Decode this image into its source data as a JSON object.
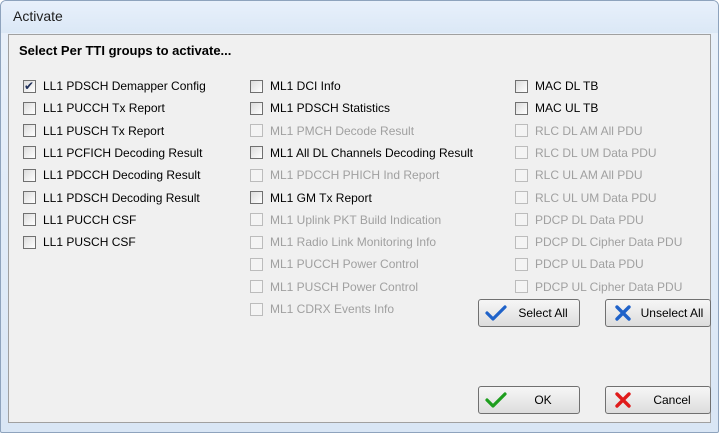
{
  "window": {
    "title": "Activate"
  },
  "header": "Select Per TTI groups to activate...",
  "columns": [
    [
      {
        "label": "LL1 PDSCH Demapper Config",
        "checked": true,
        "enabled": true
      },
      {
        "label": "LL1 PUCCH Tx Report",
        "checked": false,
        "enabled": true
      },
      {
        "label": "LL1 PUSCH Tx Report",
        "checked": false,
        "enabled": true
      },
      {
        "label": "LL1 PCFICH Decoding Result",
        "checked": false,
        "enabled": true
      },
      {
        "label": "LL1 PDCCH Decoding Result",
        "checked": false,
        "enabled": true
      },
      {
        "label": "LL1 PDSCH Decoding Result",
        "checked": false,
        "enabled": true
      },
      {
        "label": "LL1 PUCCH CSF",
        "checked": false,
        "enabled": true
      },
      {
        "label": "LL1 PUSCH CSF",
        "checked": false,
        "enabled": true
      }
    ],
    [
      {
        "label": "ML1 DCI Info",
        "checked": false,
        "enabled": true
      },
      {
        "label": "ML1 PDSCH Statistics",
        "checked": false,
        "enabled": true
      },
      {
        "label": "ML1 PMCH Decode Result",
        "checked": false,
        "enabled": false
      },
      {
        "label": "ML1 All DL Channels Decoding Result",
        "checked": false,
        "enabled": true
      },
      {
        "label": "ML1 PDCCH PHICH Ind Report",
        "checked": false,
        "enabled": false
      },
      {
        "label": "ML1 GM Tx Report",
        "checked": false,
        "enabled": true
      },
      {
        "label": "ML1 Uplink PKT Build Indication",
        "checked": false,
        "enabled": false
      },
      {
        "label": "ML1 Radio Link Monitoring Info",
        "checked": false,
        "enabled": false
      },
      {
        "label": "ML1 PUCCH Power Control",
        "checked": false,
        "enabled": false
      },
      {
        "label": "ML1 PUSCH Power Control",
        "checked": false,
        "enabled": false
      },
      {
        "label": "ML1 CDRX Events Info",
        "checked": false,
        "enabled": false
      }
    ],
    [
      {
        "label": "MAC DL TB",
        "checked": false,
        "enabled": true
      },
      {
        "label": "MAC UL TB",
        "checked": false,
        "enabled": true
      },
      {
        "label": "RLC DL AM All PDU",
        "checked": false,
        "enabled": false
      },
      {
        "label": "RLC DL UM Data PDU",
        "checked": false,
        "enabled": false
      },
      {
        "label": "RLC UL AM All PDU",
        "checked": false,
        "enabled": false
      },
      {
        "label": "RLC UL UM Data PDU",
        "checked": false,
        "enabled": false
      },
      {
        "label": "PDCP DL Data PDU",
        "checked": false,
        "enabled": false
      },
      {
        "label": "PDCP DL Cipher Data PDU",
        "checked": false,
        "enabled": false
      },
      {
        "label": "PDCP UL Data PDU",
        "checked": false,
        "enabled": false
      },
      {
        "label": "PDCP UL Cipher Data PDU",
        "checked": false,
        "enabled": false
      }
    ]
  ],
  "buttons": {
    "select_all": "Select All",
    "unselect_all": "Unselect All",
    "ok": "OK",
    "cancel": "Cancel"
  },
  "icons": {
    "select_all": "blue-check-icon",
    "unselect_all": "blue-x-icon",
    "ok": "green-check-icon",
    "cancel": "red-x-icon"
  },
  "colors": {
    "title_bar": "#dbe8f6",
    "client_bg": "#f0f0f0",
    "disabled_text": "#a0a0a0",
    "blue_icon": "#1f62c9",
    "green_icon": "#1e9e1e",
    "red_icon": "#e01b1b"
  }
}
